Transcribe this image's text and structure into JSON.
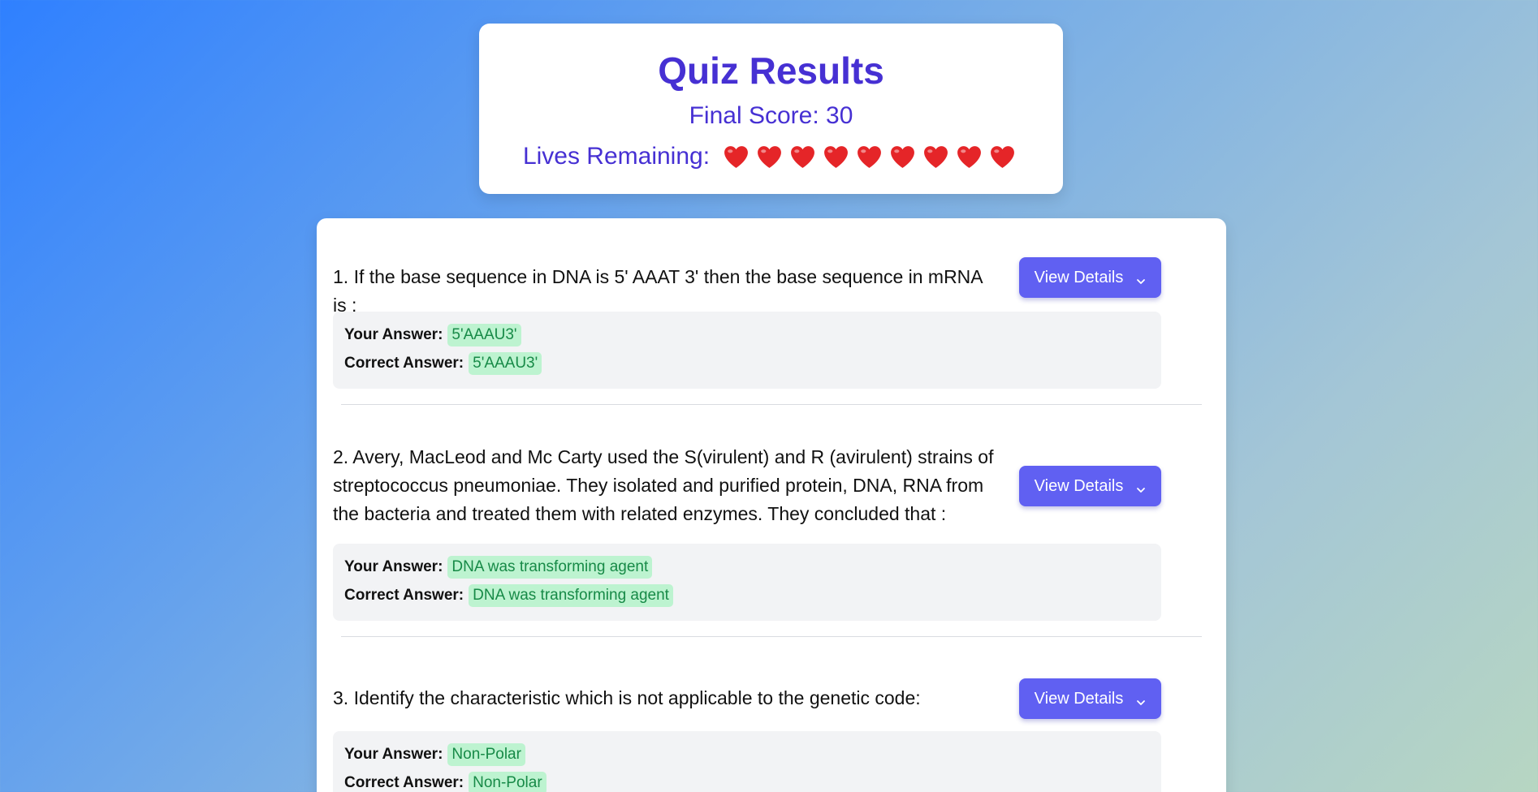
{
  "header": {
    "title": "Quiz Results",
    "score_text": "Final Score: 30",
    "lives_label": "Lives Remaining:",
    "lives_count": 9,
    "heart_color": "#e52528"
  },
  "questions": [
    {
      "text": "1. If the base sequence in DNA is 5' AAAT 3' then the base sequence in mRNA is :",
      "button_label": "View Details",
      "your_answer_label": "Your Answer:",
      "your_answer": "5'AAAU3'",
      "correct_answer_label": "Correct Answer:",
      "correct_answer": "5'AAAU3'"
    },
    {
      "text": "2. Avery, MacLeod and Mc Carty used the S(virulent) and R (avirulent) strains of streptococcus pneumoniae. They isolated and purified protein, DNA, RNA from the bacteria and treated them with related enzymes. They concluded that :",
      "button_label": "View Details",
      "your_answer_label": "Your Answer:",
      "your_answer": "DNA was transforming agent",
      "correct_answer_label": "Correct Answer:",
      "correct_answer": "DNA was transforming agent"
    },
    {
      "text": "3. Identify the characteristic which is not applicable to the genetic code:",
      "button_label": "View Details",
      "your_answer_label": "Your Answer:",
      "your_answer": "Non-Polar",
      "correct_answer_label": "Correct Answer:",
      "correct_answer": "Non-Polar"
    }
  ],
  "colors": {
    "accent": "#4630d3",
    "button": "#6060f2",
    "correct_pill_bg": "#bdf3d0",
    "correct_pill_text": "#178a47"
  },
  "icons": {
    "heart": "heart-icon",
    "chevron": "chevron-down-icon"
  }
}
